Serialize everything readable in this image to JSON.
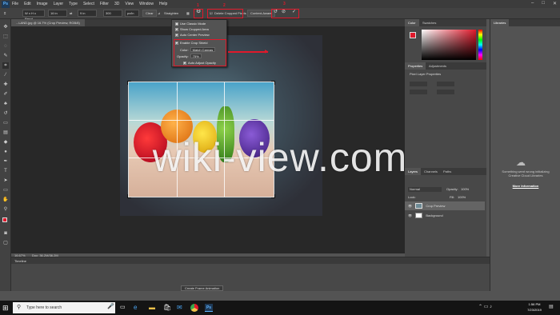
{
  "menubar": {
    "logo": "Ps",
    "items": [
      "File",
      "Edit",
      "Image",
      "Layer",
      "Type",
      "Select",
      "Filter",
      "3D",
      "View",
      "Window",
      "Help"
    ],
    "window_controls": [
      "–",
      "□",
      "✕"
    ]
  },
  "options": {
    "ratio": "W x H x Resol...",
    "width_value": "16 in",
    "height_value": "9 in",
    "resolution_value": "300",
    "resolution_unit": "px/in",
    "clear_label": "Clear",
    "straighten_label": "Straighten",
    "delete_cropped_label": "Delete Cropped Pixels",
    "content_aware_label": "Content-Aware",
    "commit_glyph": "✓",
    "cancel_glyph": "⊘",
    "reset_glyph": "↺",
    "annotations": [
      "1",
      "2",
      "3"
    ]
  },
  "gear_menu": {
    "use_classic": "Use Classic Mode",
    "show_cropped": "Show Cropped Area",
    "auto_center": "Auto Center Preview",
    "enable_shield": "Enable Crop Shield",
    "color_label": "Color:",
    "color_value": "Match Canvas",
    "opacity_label": "Opacity:",
    "opacity_value": "75%",
    "auto_adjust": "Auto Adjust Opacity"
  },
  "document": {
    "tab_title": "...LAND.jpg @ 16.7% (Crop Preview, RGB/8)",
    "zoom": "16.67%",
    "doc_info": "Doc: 36.2M/36.2M"
  },
  "panels": {
    "color_tab": "Color",
    "swatches_tab": "Swatches",
    "properties_tab": "Properties",
    "adjustments_tab": "Adjustments",
    "pixel_layer": "Pixel Layer Properties",
    "libraries_tab": "Libraries",
    "libraries_msg": "Something went wrong initializing Creative Cloud Libraries",
    "more_info": "More Information",
    "layers_tabs": [
      "Layers",
      "Channels",
      "Paths"
    ],
    "blend_mode": "Normal",
    "opacity_label": "Opacity:",
    "opacity_value": "100%",
    "lock_label": "Lock:",
    "fill_label": "Fill:",
    "fill_value": "100%",
    "layers": [
      "Crop Preview",
      "Background"
    ]
  },
  "timeline": {
    "title": "Timeline",
    "create_button": "Create Frame Animation"
  },
  "taskbar": {
    "search_placeholder": "Type here to search",
    "time": "1:56 PM",
    "date": "7/23/2019"
  },
  "watermark": "wiki-view.com",
  "colors": {
    "accent_red": "#e0192b",
    "panel": "#535353",
    "dark": "#2b2b2b"
  }
}
